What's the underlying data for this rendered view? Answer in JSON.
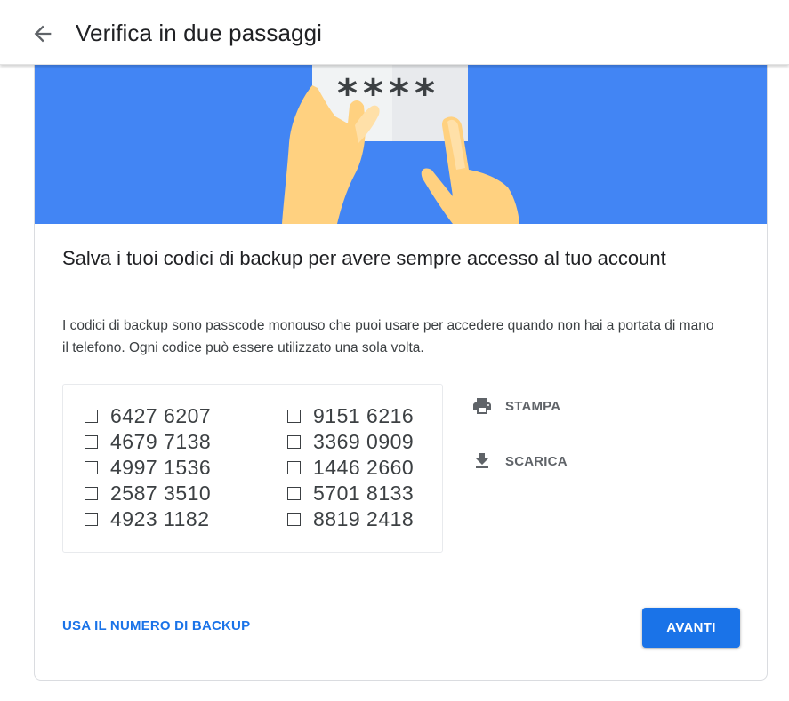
{
  "header": {
    "title": "Verifica in due passaggi",
    "back_icon": "arrow-back-icon"
  },
  "illustration": {
    "masked_code": "****",
    "background_color": "#4285f4"
  },
  "content": {
    "heading": "Salva i tuoi codici di backup per avere sempre accesso al tuo account",
    "description": "I codici di backup sono passcode monouso che puoi usare per accedere quando non hai a portata di mano il telefono. Ogni codice può essere utilizzato una sola volta."
  },
  "codes": {
    "left": [
      "6427 6207",
      "4679 7138",
      "4997 1536",
      "2587 3510",
      "4923 1182"
    ],
    "right": [
      "9151 6216",
      "3369 0909",
      "1446 2660",
      "5701 8133",
      "8819 2418"
    ]
  },
  "actions": {
    "print_label": "STAMPA",
    "print_icon": "printer-icon",
    "download_label": "SCARICA",
    "download_icon": "download-icon"
  },
  "footer": {
    "backup_number_link": "USA IL NUMERO DI BACKUP",
    "next_button": "AVANTI"
  },
  "colors": {
    "accent": "#1a73e8",
    "hero": "#4285f4"
  }
}
